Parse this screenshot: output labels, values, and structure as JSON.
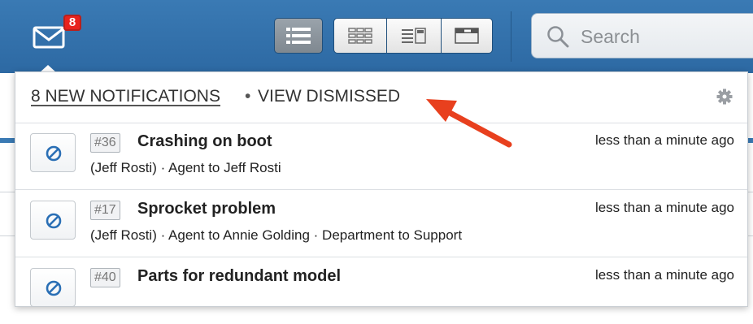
{
  "toolbar": {
    "notification_count": "8",
    "search_placeholder": "Search"
  },
  "notifications": {
    "header": {
      "new_label": "8 NEW NOTIFICATIONS",
      "separator": "•",
      "dismissed_label": "VIEW DISMISSED"
    },
    "items": [
      {
        "id": "#36",
        "title": "Crashing on boot",
        "time": "less than a minute ago",
        "detail": "(Jeff Rosti) · Agent to Jeff Rosti"
      },
      {
        "id": "#17",
        "title": "Sprocket problem",
        "time": "less than a minute ago",
        "detail": "(Jeff Rosti) · Agent to Annie Golding · Department to Support"
      },
      {
        "id": "#40",
        "title": "Parts for redundant model",
        "time": "less than a minute ago",
        "detail": ""
      }
    ]
  },
  "icons": {
    "mail": "mail-icon",
    "list_view": "list-view-icon",
    "grid_view": "grid-view-icon",
    "split_view": "split-view-icon",
    "detail_view": "detail-view-icon",
    "search": "search-icon",
    "gear": "gear-icon",
    "dismiss": "dismiss-icon"
  },
  "colors": {
    "toolbar": "#2d69a3",
    "badge": "#e8231e",
    "annotation_arrow": "#e8401e",
    "dismiss_icon": "#2a6fb5"
  }
}
